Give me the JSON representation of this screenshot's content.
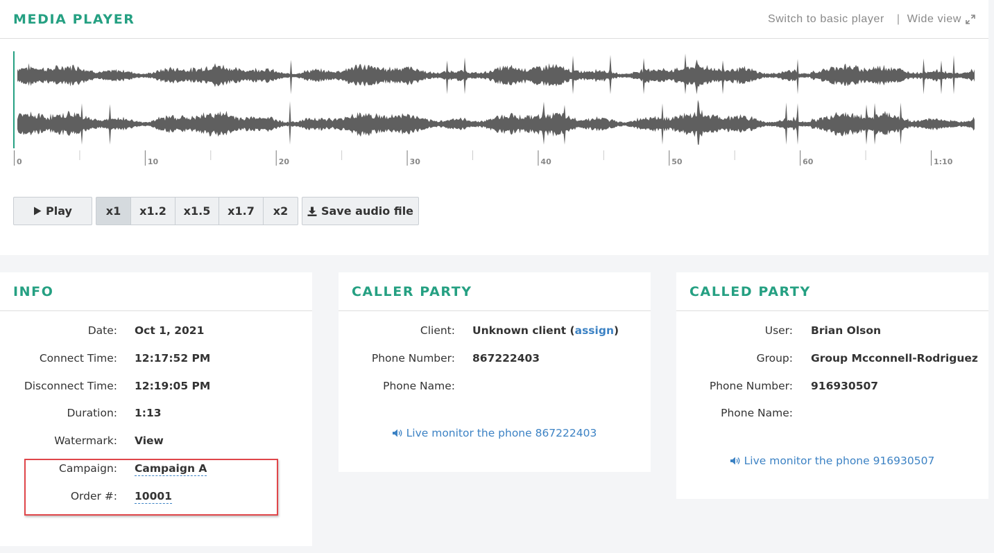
{
  "player": {
    "title": "MEDIA PLAYER",
    "switch_label": "Switch to basic player",
    "separator": "|",
    "wide_label": "Wide view",
    "timeline_ticks": [
      "0",
      "10",
      "20",
      "30",
      "40",
      "50",
      "60",
      "1:10"
    ],
    "play_label": "Play",
    "speeds": [
      "x1",
      "x1.2",
      "x1.5",
      "x1.7",
      "x2"
    ],
    "active_speed": "x1",
    "save_label": "Save audio file",
    "duration_seconds": 73,
    "playhead_seconds": 0
  },
  "info": {
    "title": "INFO",
    "date_label": "Date:",
    "date": "Oct 1, 2021",
    "connect_label": "Connect Time:",
    "connect": "12:17:52 PM",
    "disconnect_label": "Disconnect Time:",
    "disconnect": "12:19:05 PM",
    "duration_label": "Duration:",
    "duration": "1:13",
    "watermark_label": "Watermark:",
    "watermark": "View",
    "campaign_label": "Campaign:",
    "campaign": "Campaign A",
    "order_label": "Order #:",
    "order": "10001"
  },
  "caller": {
    "title": "CALLER PARTY",
    "client_label": "Client:",
    "client": "Unknown client (",
    "client_assign": "assign",
    "client_close": ")",
    "phone_label": "Phone Number:",
    "phone": "867222403",
    "phone_name_label": "Phone Name:",
    "monitor": "Live monitor the phone 867222403"
  },
  "called": {
    "title": "CALLED PARTY",
    "user_label": "User:",
    "user": "Brian Olson",
    "group_label": "Group:",
    "group": "Group Mcconnell-Rodriguez",
    "phone_label": "Phone Number:",
    "phone": "916930507",
    "phone_name_label": "Phone Name:",
    "monitor": "Live monitor the phone 916930507"
  },
  "colors": {
    "accent": "#25a082",
    "link": "#3c82c4",
    "waveform": "#5f5f5f",
    "highlight": "#e0464a"
  },
  "icons": {
    "play": "play-icon",
    "download": "download-icon",
    "expand": "expand-icon",
    "speaker": "speaker-icon"
  }
}
